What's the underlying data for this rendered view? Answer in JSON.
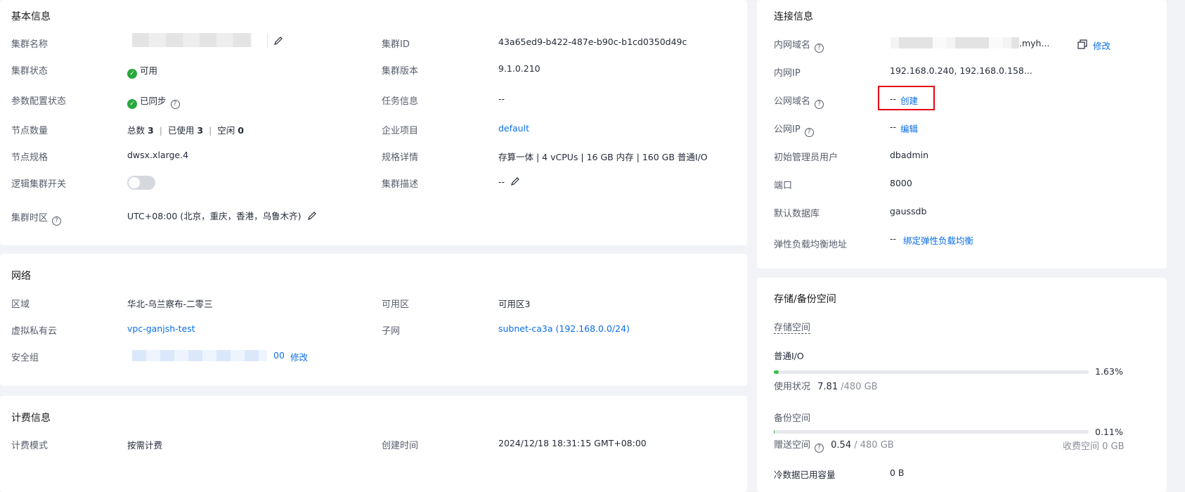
{
  "basic": {
    "title": "基本信息",
    "cluster_name_label": "集群名称",
    "cluster_id_label": "集群ID",
    "cluster_id": "43a65ed9-b422-487e-b90c-b1cd0350d49c",
    "status_label": "集群状态",
    "status": "可用",
    "version_label": "集群版本",
    "version": "9.1.0.210",
    "param_label": "参数配置状态",
    "param_status": "已同步",
    "task_label": "任务信息",
    "task": "--",
    "node_count_label": "节点数量",
    "total_label": "总数",
    "total": "3",
    "used_label": "已使用",
    "used": "3",
    "idle_label": "空闲",
    "idle": "0",
    "enterprise_label": "企业项目",
    "enterprise": "default",
    "flavor_label": "节点规格",
    "flavor": "dwsx.xlarge.4",
    "flavor_detail_label": "规格详情",
    "flavor_detail": "存算一体 | 4 vCPUs | 16 GB 内存 | 160 GB 普通I/O",
    "logical_label": "逻辑集群开关",
    "desc_label": "集群描述",
    "desc": "--",
    "timezone_label": "集群时区",
    "timezone": "UTC+08:00 (北京，重庆，香港，乌鲁木齐)"
  },
  "network": {
    "title": "网络",
    "region_label": "区域",
    "region": "华北-乌兰察布-二零三",
    "az_label": "可用区",
    "az": "可用区3",
    "vpc_label": "虚拟私有云",
    "vpc": "vpc-ganjsh-test",
    "subnet_label": "子网",
    "subnet": "subnet-ca3a (192.168.0.0/24)",
    "sg_label": "安全组",
    "sg_suffix": "00",
    "sg_modify": "修改"
  },
  "billing": {
    "title": "计费信息",
    "mode_label": "计费模式",
    "mode": "按需计费",
    "created_label": "创建时间",
    "created": "2024/12/18 18:31:15 GMT+08:00"
  },
  "connection": {
    "title": "连接信息",
    "private_domain_label": "内网域名",
    "private_domain_suffix": ".myh...",
    "private_domain_modify": "修改",
    "private_ip_label": "内网IP",
    "private_ip": "192.168.0.240, 192.168.0.158...",
    "public_domain_label": "公网域名",
    "public_domain": "--",
    "public_domain_create": "创建",
    "public_ip_label": "公网IP",
    "public_ip": "--",
    "public_ip_edit": "编辑",
    "admin_label": "初始管理员用户",
    "admin": "dbadmin",
    "port_label": "端口",
    "port": "8000",
    "db_label": "默认数据库",
    "db": "gaussdb",
    "elb_label": "弹性负载均衡地址",
    "elb": "--",
    "elb_bind": "绑定弹性负载均衡"
  },
  "storage": {
    "title": "存储/备份空间",
    "storage_space": "存储空间",
    "normal_io": "普通I/O",
    "normal_pct": "1.63%",
    "normal_fraction": 0.0163,
    "usage_label": "使用状况",
    "usage_used": "7.81",
    "usage_total": "/480 GB",
    "backup_space": "备份空间",
    "backup_pct": "0.11%",
    "backup_fraction": 0.0011,
    "gift_label": "赠送空间",
    "gift_used": "0.54",
    "gift_total": "/ 480 GB",
    "charged": "收费空间 0 GB",
    "cold_label": "冷数据已用容量",
    "cold": "0 B"
  },
  "colors": {
    "link": "#0a6ee8",
    "ok": "#29a83c",
    "highlight": "#e60012"
  }
}
